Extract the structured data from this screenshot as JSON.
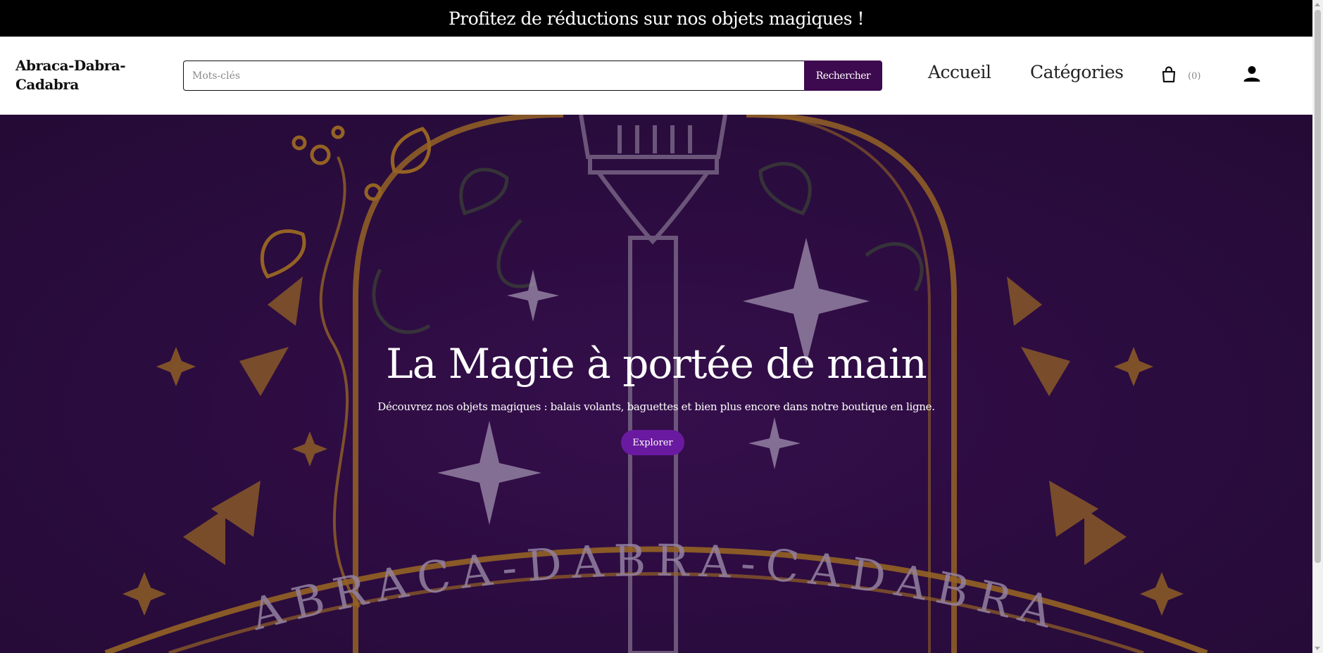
{
  "promo": {
    "text": "Profitez de réductions sur nos objets magiques !"
  },
  "header": {
    "logo": "Abraca-Dabra-Cadabra",
    "search": {
      "placeholder": "Mots-clés",
      "value": "",
      "button_label": "Rechercher"
    },
    "nav": {
      "home": "Accueil",
      "categories": "Catégories"
    },
    "cart": {
      "count_label": "(0)",
      "icon": "shopping-bag-icon"
    },
    "account": {
      "icon": "user-icon"
    }
  },
  "hero": {
    "title": "La Magie à portée de main",
    "subtitle": "Découvrez nos objets magiques : balais volants, baguettes et bien plus encore dans notre boutique en ligne.",
    "button_label": "Explorer",
    "background_banner_text": "ABRACA-DABRA-CADABRA"
  },
  "colors": {
    "promo_bg": "#000000",
    "brand_purple": "#3d0a4f",
    "hero_button": "#6a1aa0",
    "hero_bg": "#2b0c40",
    "gold_ornament": "#b8801e"
  }
}
